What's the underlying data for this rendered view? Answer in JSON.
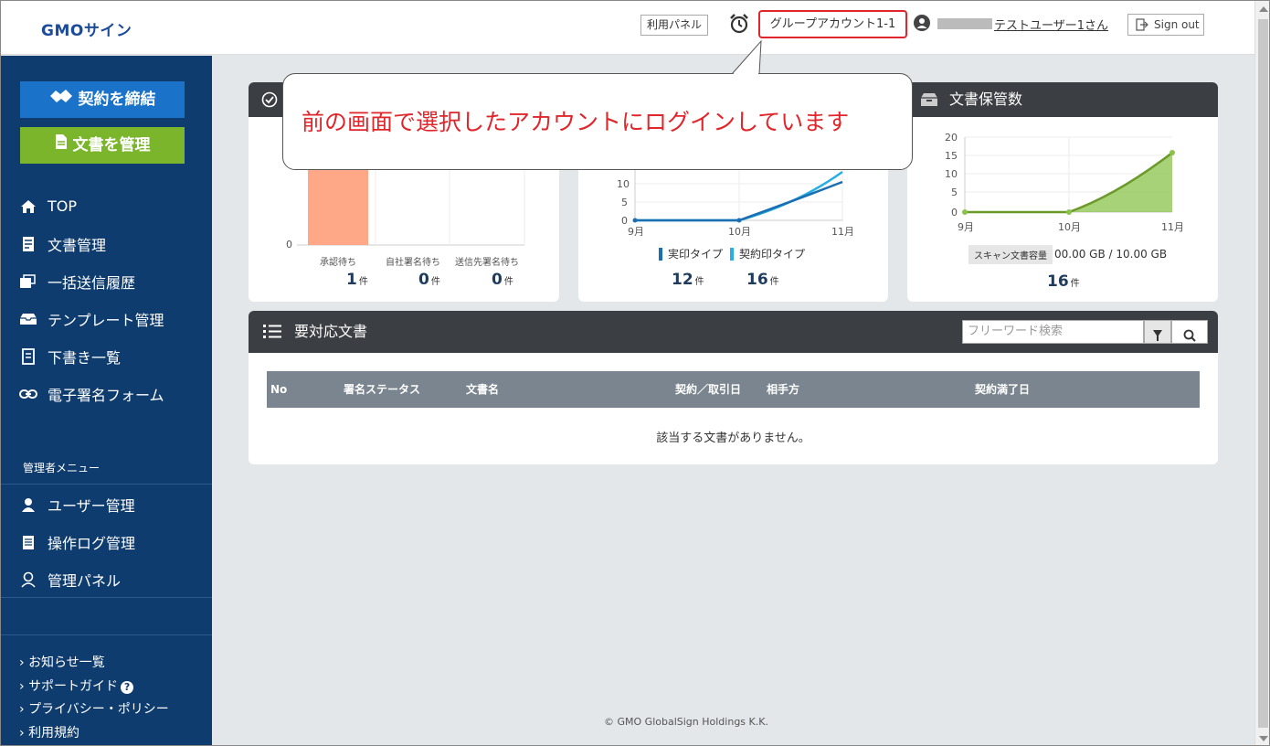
{
  "header": {
    "logo": "GMOサイン",
    "panel_button": "利用パネル",
    "account": "グループアカウント1-1",
    "user_name": "テストユーザー1さん",
    "signout": "Sign out"
  },
  "sidebar": {
    "btn_contract": "契約を締結",
    "btn_docs": "文書を管理",
    "nav": [
      {
        "label": "TOP",
        "icon": "home-icon"
      },
      {
        "label": "文書管理",
        "icon": "document-icon"
      },
      {
        "label": "一括送信履歴",
        "icon": "bulk-send-icon"
      },
      {
        "label": "テンプレート管理",
        "icon": "template-icon"
      },
      {
        "label": "下書き一覧",
        "icon": "draft-icon"
      },
      {
        "label": "電子署名フォーム",
        "icon": "link-icon"
      }
    ],
    "admin_title": "管理者メニュー",
    "admin_nav": [
      {
        "label": "ユーザー管理",
        "icon": "user-icon"
      },
      {
        "label": "操作ログ管理",
        "icon": "log-icon"
      },
      {
        "label": "管理パネル",
        "icon": "admin-panel-icon"
      }
    ],
    "footer_links": [
      "お知らせ一覧",
      "サポートガイド",
      "プライバシー・ポリシー",
      "利用規約"
    ]
  },
  "card1": {
    "categories": [
      "承認待ち",
      "自社署名待ち",
      "送信先署名待ち"
    ],
    "counts": [
      "1",
      "0",
      "0"
    ],
    "unit": "件",
    "y0": "0"
  },
  "card2": {
    "legend": [
      "実印タイプ",
      "契約印タイプ"
    ],
    "counts": [
      "12",
      "16"
    ],
    "unit": "件",
    "x_labels": [
      "9月",
      "10月",
      "11月"
    ],
    "y_labels": [
      "10",
      "5",
      "0"
    ],
    "colors": {
      "jitsuin": "#1a6fb3",
      "keiyaku": "#27aee3"
    }
  },
  "card3": {
    "title": "文書保管数",
    "x_labels": [
      "9月",
      "10月",
      "11月"
    ],
    "y_labels": [
      "20",
      "15",
      "10",
      "5",
      "0"
    ],
    "storage_label": "スキャン文書容量",
    "storage_value": "00.00 GB / 10.00 GB",
    "count": "16",
    "unit": "件",
    "color": "#8bc34a"
  },
  "chart_data": [
    {
      "type": "bar",
      "categories": [
        "承認待ち",
        "自社署名待ち",
        "送信先署名待ち"
      ],
      "values": [
        1,
        0,
        0
      ]
    },
    {
      "type": "line",
      "categories": [
        "9月",
        "10月",
        "11月"
      ],
      "series": [
        {
          "name": "実印タイプ",
          "values": [
            0,
            0,
            12
          ]
        },
        {
          "name": "契約印タイプ",
          "values": [
            0,
            0,
            16
          ]
        }
      ]
    },
    {
      "type": "area",
      "title": "文書保管数",
      "categories": [
        "9月",
        "10月",
        "11月"
      ],
      "values": [
        0,
        0,
        16
      ],
      "ylim": [
        0,
        20
      ]
    }
  ],
  "table": {
    "title": "要対応文書",
    "search_placeholder": "フリーワード検索",
    "columns": [
      "No",
      "署名ステータス",
      "文書名",
      "契約／取引日",
      "相手方",
      "契約満了日"
    ],
    "empty": "該当する文書がありません。"
  },
  "copyright": "© GMO GlobalSign Holdings K.K.",
  "callout": "前の画面で選択したアカウントにログインしています"
}
